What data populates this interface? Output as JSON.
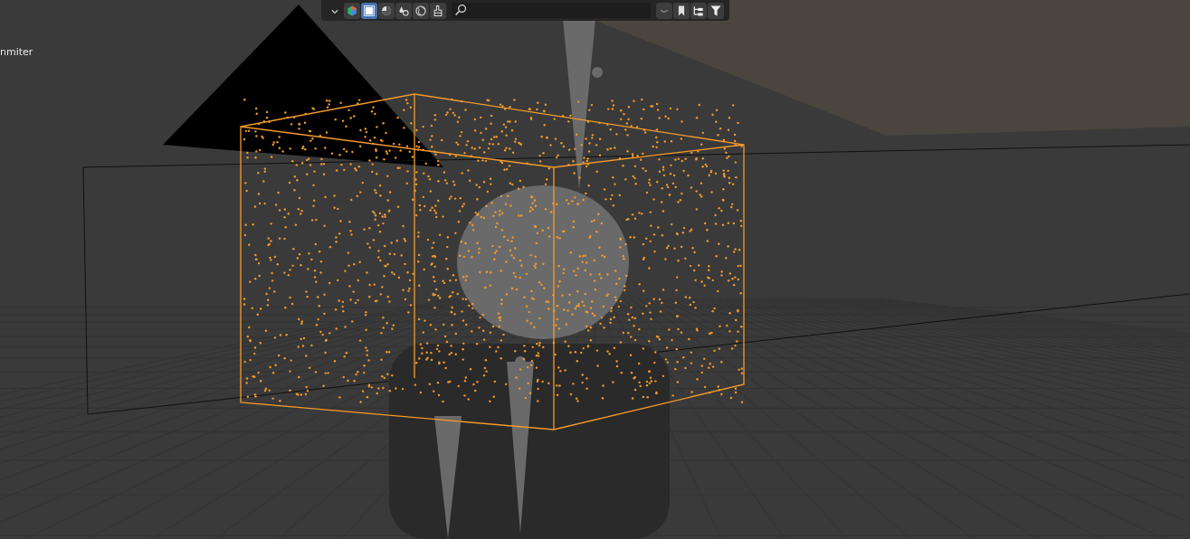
{
  "viewport": {
    "object_label": "nmiter"
  },
  "header": {
    "toggles": [
      {
        "kind": "caret",
        "selected": false
      },
      {
        "kind": "hexagon",
        "selected": false
      },
      {
        "kind": "square",
        "selected": true
      },
      {
        "kind": "sphere",
        "selected": false
      },
      {
        "kind": "drops",
        "selected": false
      },
      {
        "kind": "globe",
        "selected": false
      },
      {
        "kind": "brush",
        "selected": false
      }
    ],
    "tools": [
      {
        "kind": "collapse",
        "selected": false
      },
      {
        "kind": "bookmark",
        "selected": false
      },
      {
        "kind": "hierarchy",
        "selected": false
      },
      {
        "kind": "filter",
        "selected": false
      }
    ]
  }
}
